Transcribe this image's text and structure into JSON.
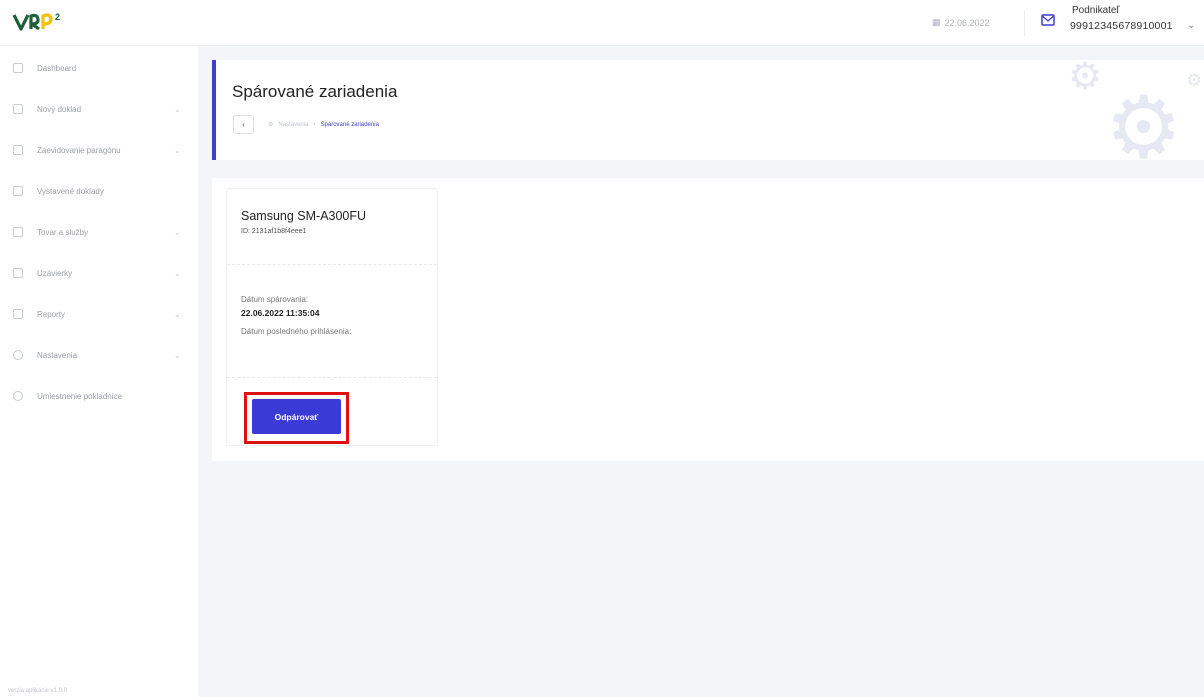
{
  "topbar": {
    "date": "22.06.2022",
    "user_role": "Podnikateľ",
    "user_id": "99912345678910001",
    "icons": {
      "calendar": "calendar-icon",
      "mail": "mail-icon",
      "chevron": "chevron-down-icon"
    }
  },
  "sidebar": {
    "items": [
      {
        "label": "Dashboard",
        "icon": "dashboard-icon",
        "has_submenu": false
      },
      {
        "label": "Nový doklad",
        "icon": "document-icon",
        "has_submenu": true
      },
      {
        "label": "Zaevidovanie paragónu",
        "icon": "receipt-icon",
        "has_submenu": true
      },
      {
        "label": "Vystavené doklady",
        "icon": "documents-icon",
        "has_submenu": false
      },
      {
        "label": "Tovar a služby",
        "icon": "goods-icon",
        "has_submenu": true
      },
      {
        "label": "Uzávierky",
        "icon": "closing-icon",
        "has_submenu": true
      },
      {
        "label": "Reporty",
        "icon": "reports-icon",
        "has_submenu": true
      },
      {
        "label": "Nastavenia",
        "icon": "settings-icon",
        "has_submenu": true
      },
      {
        "label": "Umiestnenie pokladnice",
        "icon": "location-icon",
        "has_submenu": false
      }
    ],
    "footer": "verzia aplikácie v1.0.0"
  },
  "page": {
    "title": "Spárované zariadenia",
    "back_label": "‹",
    "breadcrumb": [
      "Nastavenia",
      "Spárované zariadenia"
    ]
  },
  "device": {
    "name": "Samsung SM-A300FU",
    "id_text": "ID: 2131af1b8f4eee1",
    "paired_label": "Dátum spárovania:",
    "paired_value": "22.06.2022 11:35:04",
    "last_login_label": "Dátum posledného prihlásenia:",
    "unpair_label": "Odpárovať"
  },
  "colors": {
    "accent": "#3f3fcf",
    "button": "#3a3ad6",
    "highlight": "#e01010"
  }
}
